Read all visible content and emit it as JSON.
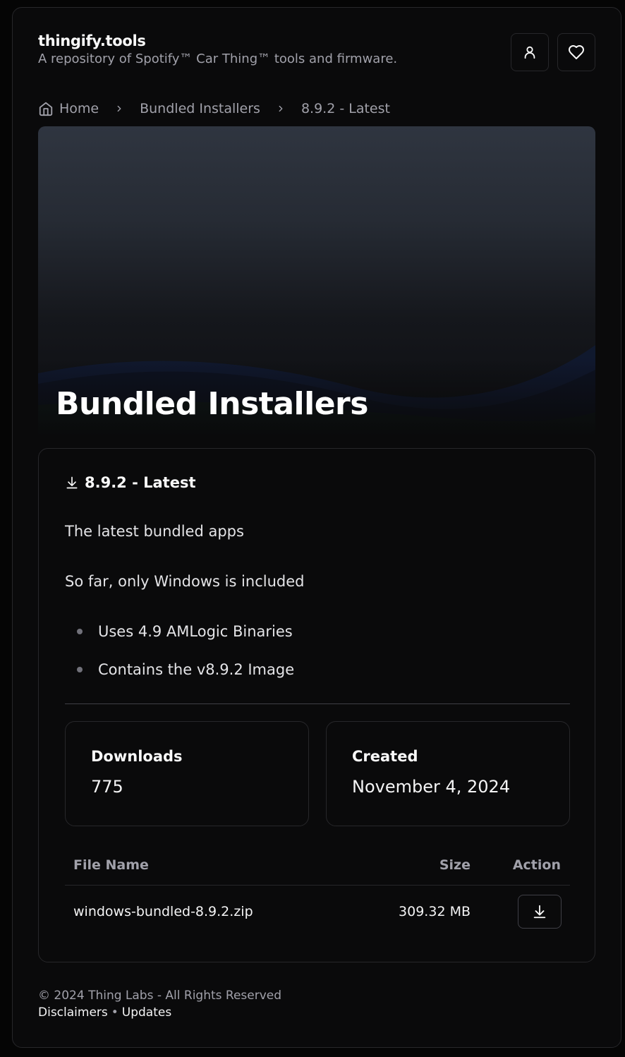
{
  "header": {
    "brand": "thingify.tools",
    "tagline": "A repository of Spotify™ Car Thing™ tools and firmware.",
    "user_icon": "user-icon",
    "favorites_icon": "heart-icon"
  },
  "breadcrumb": {
    "home": "Home",
    "section": "Bundled Installers",
    "current": "8.9.2 - Latest"
  },
  "hero": {
    "title": "Bundled Installers"
  },
  "release": {
    "title": "8.9.2 - Latest",
    "description": [
      "The latest bundled apps",
      "So far, only Windows is included"
    ],
    "bullets": [
      "Uses 4.9 AMLogic Binaries",
      "Contains the v8.9.2 Image"
    ]
  },
  "stats": {
    "downloads_label": "Downloads",
    "downloads_value": "775",
    "created_label": "Created",
    "created_value": "November 4, 2024"
  },
  "files": {
    "columns": [
      "File Name",
      "Size",
      "Action"
    ],
    "rows": [
      {
        "name": "windows-bundled-8.9.2.zip",
        "size": "309.32 MB"
      }
    ]
  },
  "footer": {
    "copyright": "© 2024 Thing Labs - All Rights Reserved",
    "links": [
      "Disclaimers",
      "Updates"
    ],
    "separator": "•"
  }
}
